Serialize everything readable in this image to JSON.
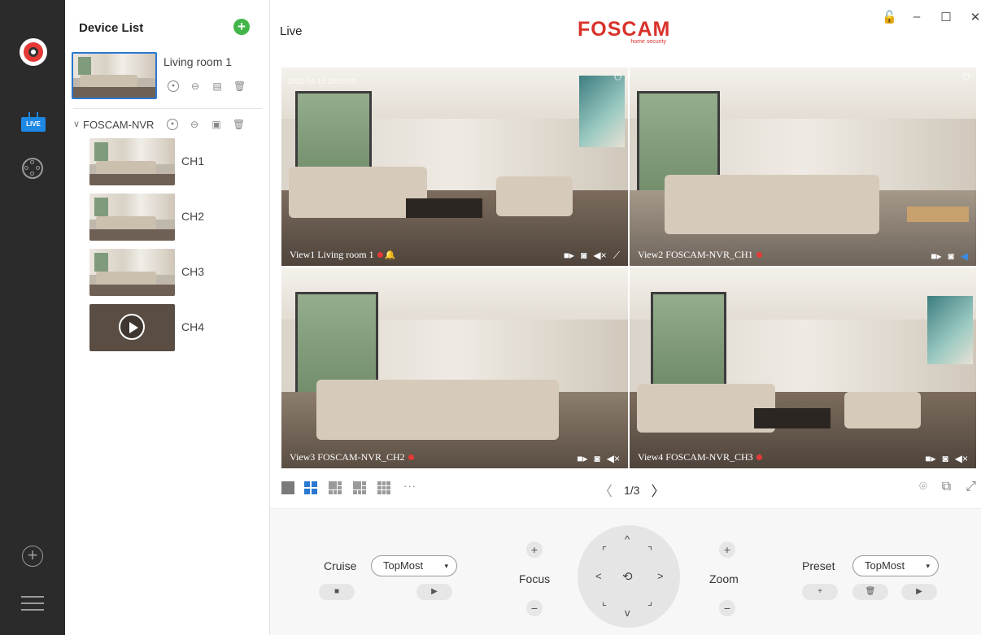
{
  "rail": {
    "live_badge": "LIVE"
  },
  "device_list": {
    "title": "Device List",
    "add_symbol": "+",
    "devices": [
      {
        "name": "Living room 1"
      }
    ],
    "nvr": {
      "name": "FOSCAM-NVR",
      "channels": [
        {
          "name": "CH1"
        },
        {
          "name": "CH2"
        },
        {
          "name": "CH3"
        },
        {
          "name": "CH4"
        }
      ]
    }
  },
  "header": {
    "title": "Live",
    "brand": "FOSCAM",
    "brand_sub": "home security",
    "window_controls": [
      "🔓",
      "–",
      "☐",
      "✕"
    ]
  },
  "views": [
    {
      "label": "View1 Living room 1",
      "timestamp": "2020-04-15 20:00:00",
      "selected": true
    },
    {
      "label": "View2 FOSCAM-NVR_CH1",
      "selected": false
    },
    {
      "label": "View3 FOSCAM-NVR_CH2",
      "selected": false
    },
    {
      "label": "View4 FOSCAM-NVR_CH3",
      "selected": false
    }
  ],
  "layout_bar": {
    "more": "···",
    "page_indicator": "1/3",
    "prev": "〈",
    "next": "〉"
  },
  "ptz": {
    "cruise_label": "Cruise",
    "cruise_value": "TopMost",
    "focus_label": "Focus",
    "zoom_label": "Zoom",
    "preset_label": "Preset",
    "preset_value": "TopMost",
    "plus": "+",
    "minus": "−"
  },
  "colors": {
    "rail_bg": "#2b2b2b",
    "accent_blue": "#2b78d0",
    "brand_red": "#d9322b",
    "add_green": "#43b649",
    "rec_red": "#e53935"
  }
}
